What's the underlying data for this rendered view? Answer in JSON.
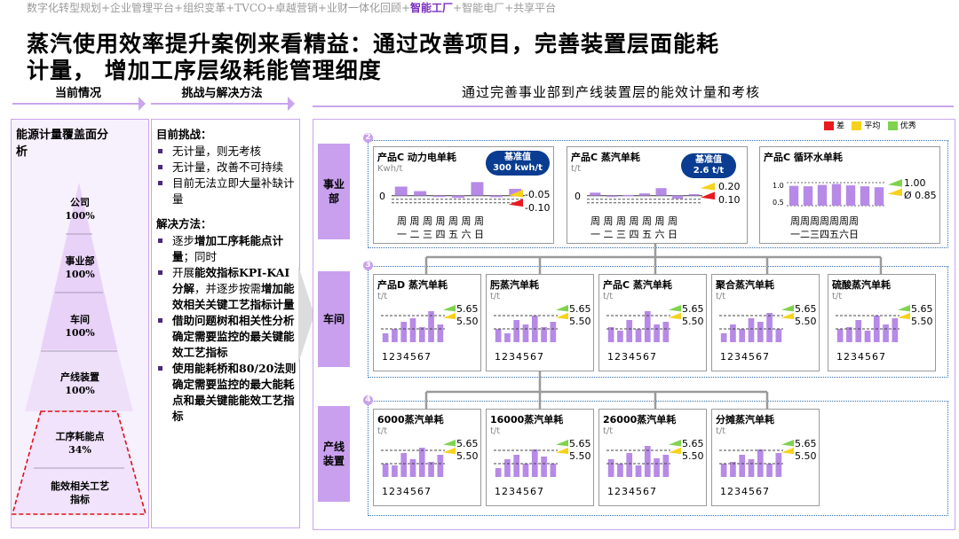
{
  "breadcrumb": {
    "pre": "数字化转型规划+企业管理平台+组织变革+TVCO+卓越营销+业财一体化回顾+",
    "highlight": "智能工厂",
    "post": "+智能电厂+共享平台"
  },
  "title": {
    "line1": "蒸汽使用效率提升案例来看精益：通过改善项目，完善装置层面能耗",
    "line2": "计量， 增加工序层级耗能管理细度"
  },
  "tabs": {
    "current": "当前情况",
    "challenge": "挑战与解决方法"
  },
  "subheading": "通过完善事业部到产线装置层的能效计量和考核",
  "pyramid": {
    "title": "能源计量覆盖面分析",
    "levels": [
      {
        "name": "公司",
        "value": "100%"
      },
      {
        "name": "事业部",
        "value": "100%"
      },
      {
        "name": "车间",
        "value": "100%"
      },
      {
        "name": "产线装置",
        "value": "100%"
      },
      {
        "name": "工序耗能点",
        "value": "34%"
      },
      {
        "name": "能效相关工艺指标",
        "value": ""
      }
    ]
  },
  "challenges": {
    "heading": "目前挑战：",
    "items": [
      "无计量，则无考核",
      "无计量，改善不可持续",
      "目前无法立即大量补缺计量"
    ]
  },
  "solutions": {
    "heading": "解决方法：",
    "items": [
      {
        "pre": "逐步",
        "bold": "增加工序耗能点计量",
        "post": "；同时"
      },
      {
        "pre": "开展",
        "bold": "能效指标KPI-KAI分解",
        "post": "，并逐步按需",
        "bold2": "增加能效相关关键工艺指标计量"
      },
      {
        "pre": "",
        "bold": "借助问题树和相关性分析确定需要监控的最关键能效工艺指标",
        "post": ""
      },
      {
        "pre": "",
        "bold": "使用能耗桥和80/20法则确定需要监控的最大能耗点和最关键能能效工艺指标",
        "post": ""
      }
    ]
  },
  "legend": [
    {
      "label": "差",
      "color": "#e8191f"
    },
    {
      "label": "平均",
      "color": "#f7d21c"
    },
    {
      "label": "优秀",
      "color": "#7fd34e"
    }
  ],
  "rows": [
    {
      "label": "事业部",
      "badge": "2"
    },
    {
      "label": "车间",
      "badge": "3"
    },
    {
      "label": "产线装置",
      "badge": "4"
    }
  ],
  "division_cards": [
    {
      "title": "产品C 动力电单耗",
      "unit": "Kwh/t",
      "zero": "0",
      "baseline": {
        "label": "基准值",
        "value": "300 kwh/t"
      },
      "thr": [
        "-0.05",
        "-0.10"
      ],
      "days": "周 周 周 周 周 周 周",
      "days2": "一 二 三 四 五 六 日",
      "values": [
        0.6,
        0.3,
        -0.05,
        -0.15,
        0.9,
        -0.1,
        0.45
      ]
    },
    {
      "title": "产品C 蒸汽单耗",
      "unit": "t/t",
      "zero": "0",
      "baseline": {
        "label": "基准值",
        "value": "2.6 t/t"
      },
      "thr": [
        "0.20",
        "0.10"
      ],
      "days": "周 周 周 周 周 周 周",
      "days2": "一 二 三 四 五 六 日",
      "values": [
        0.2,
        -0.05,
        0.05,
        0.15,
        0.5,
        -0.2,
        0.1
      ]
    },
    {
      "title": "产品C 循环水单耗",
      "unit": "",
      "ticks": [
        "1.0",
        "0.5"
      ],
      "thr": [
        "1.00",
        "Ø 0.85"
      ],
      "days": "周周周周周周周",
      "days2": "一二三四五六日",
      "values": [
        0.93,
        0.92,
        0.95,
        0.97,
        0.94,
        0.92,
        0.9
      ]
    }
  ],
  "workshop_cards": [
    {
      "title": "产品D 蒸汽单耗",
      "unit": "t/t",
      "thr": [
        "5.65",
        "5.50"
      ],
      "days": "1234567",
      "values": [
        5.45,
        5.5,
        5.58,
        5.62,
        5.52,
        5.7,
        5.55
      ]
    },
    {
      "title": "肟蒸汽单耗",
      "unit": "t/t",
      "thr": [
        "5.65",
        "5.50"
      ],
      "days": "1234567",
      "values": [
        5.5,
        5.45,
        5.6,
        5.55,
        5.65,
        5.52,
        5.58
      ]
    },
    {
      "title": "产品C 蒸汽单耗",
      "unit": "t/t",
      "thr": [
        "5.65",
        "5.50"
      ],
      "days": "1234567",
      "values": [
        5.52,
        5.48,
        5.6,
        5.5,
        5.7,
        5.55,
        5.58
      ]
    },
    {
      "title": "聚合蒸汽单耗",
      "unit": "t/t",
      "thr": [
        "5.65",
        "5.50"
      ],
      "days": "1234567",
      "values": [
        5.45,
        5.55,
        5.5,
        5.62,
        5.58,
        5.68,
        5.5
      ]
    },
    {
      "title": "硫酸蒸汽单耗",
      "unit": "t/t",
      "thr": [
        "5.65",
        "5.50"
      ],
      "days": "1234567",
      "values": [
        5.5,
        5.52,
        5.6,
        5.48,
        5.65,
        5.55,
        5.62
      ]
    }
  ],
  "line_cards": [
    {
      "title": "6000蒸汽单耗",
      "unit": "t/t",
      "thr": [
        "5.65",
        "5.50"
      ],
      "days": "1234567",
      "values": [
        5.5,
        5.48,
        5.62,
        5.55,
        5.68,
        5.52,
        5.6
      ]
    },
    {
      "title": "16000蒸汽单耗",
      "unit": "t/t",
      "thr": [
        "5.65",
        "5.50"
      ],
      "days": "1234567",
      "values": [
        5.45,
        5.55,
        5.6,
        5.5,
        5.66,
        5.58,
        5.5
      ]
    },
    {
      "title": "26000蒸汽单耗",
      "unit": "t/t",
      "thr": [
        "5.65",
        "5.50"
      ],
      "days": "1234567",
      "values": [
        5.55,
        5.5,
        5.62,
        5.48,
        5.7,
        5.56,
        5.6
      ]
    },
    {
      "title": "分摊蒸汽单耗",
      "unit": "t/t",
      "thr": [
        "5.65",
        "5.50"
      ],
      "days": "1234567",
      "values": [
        5.5,
        5.52,
        5.6,
        5.55,
        5.66,
        5.5,
        5.62
      ]
    }
  ]
}
